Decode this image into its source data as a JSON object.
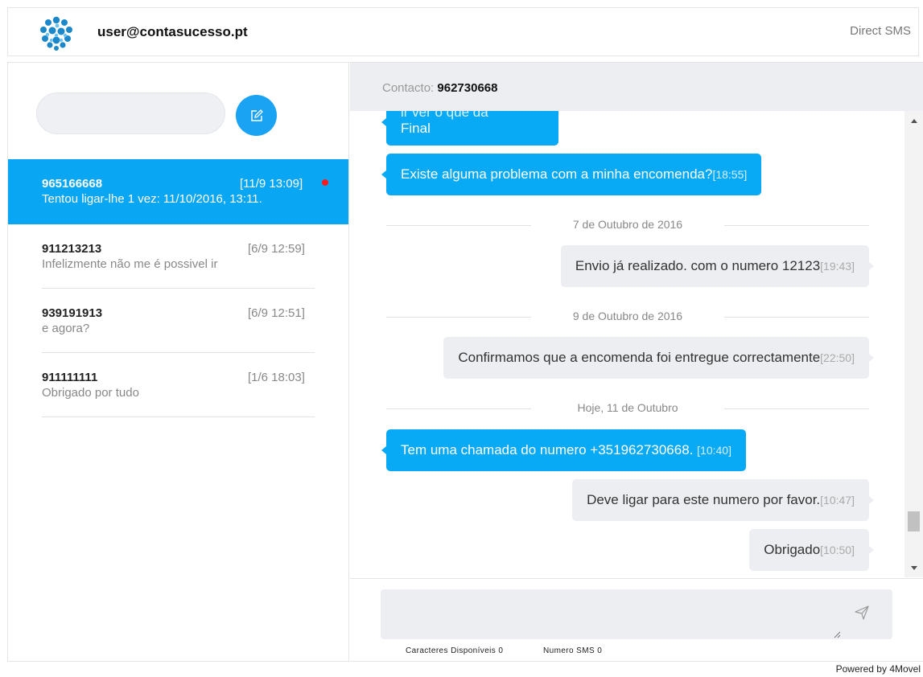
{
  "header": {
    "user_email": "user@contasucesso.pt",
    "app_name": "Direct SMS"
  },
  "sidebar": {
    "search": {
      "value": "",
      "placeholder": ""
    },
    "compose_icon": "edit-icon",
    "contacts": [
      {
        "number": "965166668",
        "time": "[11/9 13:09]",
        "preview": "Tentou ligar-lhe 1 vez: 11/10/2016, 13:11.",
        "unread": true,
        "active": true
      },
      {
        "number": "911213213",
        "time": "[6/9 12:59]",
        "preview": "Infelizmente não me é possivel ir",
        "unread": false,
        "active": false
      },
      {
        "number": "939191913",
        "time": "[6/9 12:51]",
        "preview": "e agora?",
        "unread": false,
        "active": false
      },
      {
        "number": "911111111",
        "time": "[1/6 18:03]",
        "preview": "Obrigado por tudo",
        "unread": false,
        "active": false
      }
    ]
  },
  "chat": {
    "contact_label": "Contacto:",
    "contact_number": "962730668",
    "messages": [
      {
        "direction": "in",
        "text": "Final",
        "partial_text": "ir ver o que da",
        "time": ""
      },
      {
        "direction": "in",
        "text": "Existe alguma problema com a minha encomenda?",
        "time": "[18:55]"
      },
      {
        "type": "date",
        "text": "7 de Outubro de 2016"
      },
      {
        "direction": "out",
        "text": "Envio já realizado. com o numero 12123",
        "time": "[19:43]"
      },
      {
        "type": "date",
        "text": "9 de Outubro de 2016"
      },
      {
        "direction": "out",
        "text": "Confirmamos que a encomenda foi entregue correctamente",
        "time": "[22:50]"
      },
      {
        "type": "date",
        "text": "Hoje, 11 de Outubro"
      },
      {
        "direction": "in",
        "text": "Tem uma chamada do numero +351962730668.",
        "time": "[10:40]"
      },
      {
        "direction": "out",
        "text": "Deve ligar para este numero por favor.",
        "time": "[10:47]"
      },
      {
        "direction": "out",
        "text": "Obrigado",
        "time": "[10:50]"
      }
    ],
    "composer": {
      "value": "",
      "placeholder": "",
      "chars_label": "Caracteres Disponíveis",
      "chars_value": "0",
      "sms_label": "Numero SMS",
      "sms_value": "0",
      "send_icon": "send-icon"
    }
  },
  "footer": {
    "text": "Powered by 4Movel"
  },
  "colors": {
    "accent": "#09a6f3",
    "incoming_bubble": "#08a9f5",
    "outgoing_bubble": "#eceef1",
    "unread_dot": "#ff1a1a"
  }
}
